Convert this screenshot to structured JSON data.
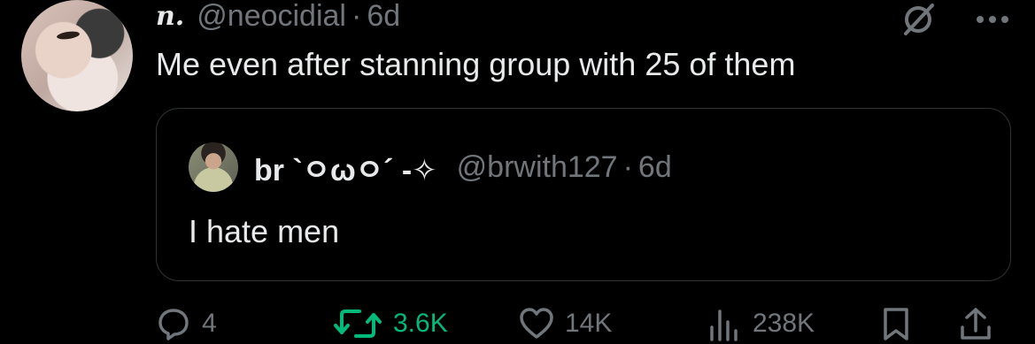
{
  "post": {
    "display_name": "n.",
    "handle": "@neocidial",
    "separator": "·",
    "time": "6d",
    "text": "Me even after stanning group with 25 of them"
  },
  "quote": {
    "display_name": "br `ㅇωㅇ´ -✧",
    "handle": "@brwith127",
    "separator": "·",
    "time": "6d",
    "text": "I hate men"
  },
  "actions": {
    "replies": "4",
    "reposts": "3.6K",
    "likes": "14K",
    "views": "238K"
  },
  "icons": {
    "grok": "grok-icon",
    "more": "more-icon",
    "reply": "reply-icon",
    "repost": "repost-icon",
    "like": "heart-icon",
    "views": "views-icon",
    "bookmark": "bookmark-icon",
    "share": "share-icon"
  },
  "colors": {
    "background": "#000000",
    "text": "#e7e9ea",
    "muted": "#71767b",
    "repost_active": "#00ba7c",
    "card_border": "#2f3336"
  }
}
